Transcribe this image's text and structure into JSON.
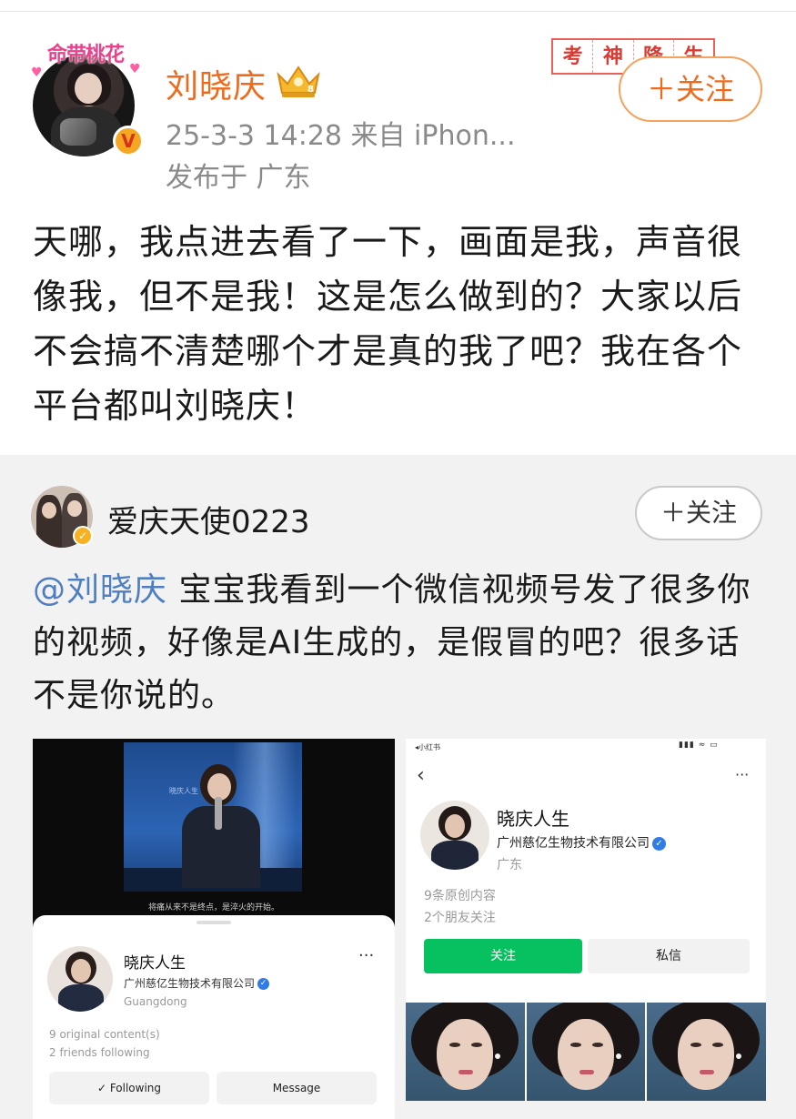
{
  "post": {
    "avatar_frame_text": "命带桃花",
    "author": "刘晓庆",
    "time": "25-3-3 14:28  来自 iPhon...",
    "location": "发布于 广东",
    "stamp_chars": [
      "考",
      "神",
      "降",
      "生"
    ],
    "follow_label": "＋关注",
    "text": "天哪，我点进去看了一下，画面是我，声音很像我，但不是我！这是怎么做到的？大家以后不会搞不清楚哪个才是真的我了吧？我在各个平台都叫刘晓庆！"
  },
  "comment": {
    "author": "爱庆天使0223",
    "follow_label": "＋关注",
    "mention": "@刘晓庆",
    "text": "  宝宝我看到一个微信视频号发了很多你的视频，好像是AI生成的，是假冒的吧？很多话不是你说的。"
  },
  "left_shot": {
    "video_caption": "将痛从来不是终点，是淬火的开始。",
    "stage_sign": "晓庆人生",
    "name": "晓庆人生",
    "company": "广州慈亿生物技术有限公司",
    "region": "Guangdong",
    "stat_content": "9 original content(s)",
    "stat_friends": "2 friends following",
    "following_label": "✓ Following",
    "message_label": "Message",
    "more_icon": "more-dots-icon"
  },
  "right_shot": {
    "status_app": "◂小红书",
    "status_icons": "▮▮▮ ≈ ▭",
    "name": "晓庆人生",
    "company": "广州慈亿生物技术有限公司",
    "region": "广东",
    "stat_content": "9条原创内容",
    "stat_friends": "2个朋友关注",
    "follow_label": "关注",
    "message_label": "私信"
  },
  "colors": {
    "author_orange": "#f06a1c",
    "mention_blue": "#4f7fc1",
    "wechat_green": "#07c160",
    "verified_blue": "#2f7be8"
  }
}
